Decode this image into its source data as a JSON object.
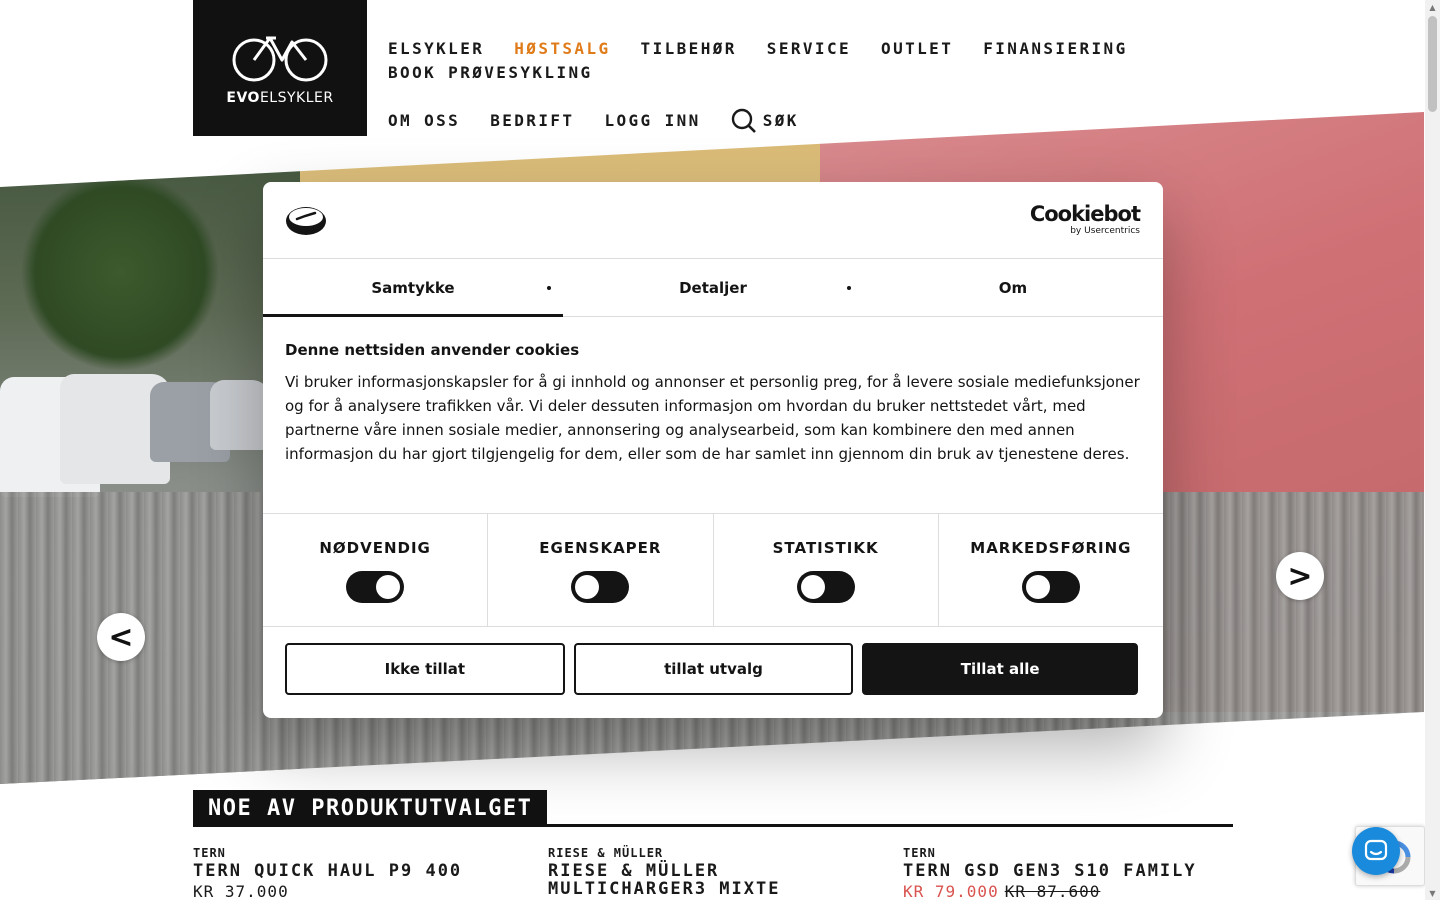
{
  "logo": {
    "brand_bold": "EVO",
    "brand_light": "ELSYKLER"
  },
  "nav": {
    "row1": [
      {
        "label": "ELSYKLER",
        "highlight": false
      },
      {
        "label": "HØSTSALG",
        "highlight": true
      },
      {
        "label": "TILBEHØR",
        "highlight": false
      },
      {
        "label": "SERVICE",
        "highlight": false
      },
      {
        "label": "OUTLET",
        "highlight": false
      },
      {
        "label": "FINANSIERING",
        "highlight": false
      },
      {
        "label": "BOOK PRØVESYKLING",
        "highlight": false
      }
    ],
    "row2": [
      "OM OSS",
      "BEDRIFT",
      "LOGG INN"
    ],
    "search_label": "SØK",
    "highlight_color": "#e07b1a"
  },
  "slider": {
    "prev": "<",
    "next": ">"
  },
  "cookie": {
    "brand_name": "Cookiebot",
    "brand_sub": "by Usercentrics",
    "tabs": [
      "Samtykke",
      "Detaljer",
      "Om"
    ],
    "active_tab": "Samtykke",
    "title": "Denne nettsiden anvender cookies",
    "text": "Vi bruker informasjonskapsler for å gi innhold og annonser et personlig preg, for å levere sosiale mediefunksjoner og for å analysere trafikken vår. Vi deler dessuten informasjon om hvordan du bruker nettstedet vårt, med partnerne våre innen sosiale medier, annonsering og analysearbeid, som kan kombinere den med annen informasjon du har gjort tilgjengelig for dem, eller som de har samlet inn gjennom din bruk av tjenestene deres.",
    "toggles": [
      {
        "label": "NØDVENDIG",
        "on": true
      },
      {
        "label": "EGENSKAPER",
        "on": false
      },
      {
        "label": "STATISTIKK",
        "on": false
      },
      {
        "label": "MARKEDSFØRING",
        "on": false
      }
    ],
    "buttons": {
      "deny": "Ikke tillat",
      "selection": "tillat utvalg",
      "allow_all": "Tillat alle"
    }
  },
  "products": {
    "section_title": "NOE AV PRODUKTUTVALGET",
    "items": [
      {
        "brand": "TERN",
        "name": "TERN QUICK HAUL P9 400",
        "price": "KR 37.000",
        "old_price": ""
      },
      {
        "brand": "RIESE & MÜLLER",
        "name": "RIESE & MÜLLER MULTICHARGER3 MIXTE",
        "price": "",
        "old_price": ""
      },
      {
        "brand": "TERN",
        "name": "TERN GSD GEN3 S10 FAMILY",
        "price": "KR 79.000",
        "old_price": "KR 87.600"
      }
    ]
  }
}
